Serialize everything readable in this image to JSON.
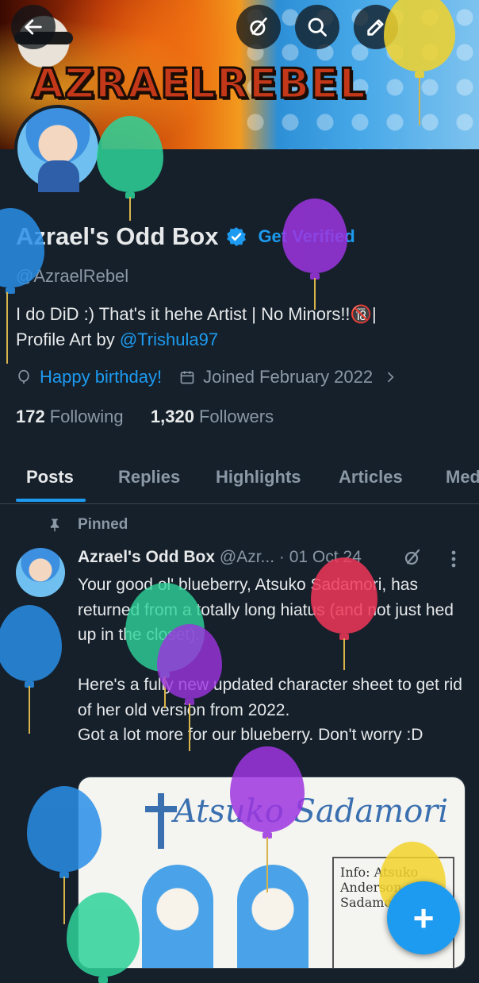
{
  "banner": {
    "title": "AZRAELREBEL"
  },
  "toolbar": {
    "back": "back",
    "grok": "grok",
    "search": "search",
    "edit": "edit"
  },
  "profile": {
    "name": "Azrael's Odd Box",
    "get_verified": "Get Verified",
    "handle": "@AzraelRebel",
    "bio_line1": "I do DiD :) That's it hehe  Artist | No Minors!!🔞|",
    "bio_line2_prefix": "Profile Art by ",
    "bio_link": "@Trishula97",
    "birthday": "Happy birthday!",
    "joined": "Joined February 2022",
    "following_count": "172",
    "following_label": "Following",
    "followers_count": "1,320",
    "followers_label": "Followers"
  },
  "tabs": [
    "Posts",
    "Replies",
    "Highlights",
    "Articles",
    "Media"
  ],
  "post": {
    "pinned_label": "Pinned",
    "author": "Azrael's Odd Box",
    "handle_short": "@Azr...",
    "date": "· 01 Oct 24",
    "text": "Your good ol' blueberry, Atsuko Sadamori, has returned from a totally long hiatus (and not just hed up in the closet).\n\nHere's a fully new updated character sheet to get rid of her old version from 2022.\nGot a lot more for our blueberry. Don't worry :D",
    "image_title": "Atsuko Sadamori",
    "image_info": "Info: Atsuko Anderson Sadamori"
  },
  "fab": "+",
  "colors": {
    "accent": "#1d9bf0",
    "background": "#15202b",
    "muted": "#8b98a5",
    "text": "#e7e9ea"
  },
  "icons": [
    "back-arrow-icon",
    "grok-icon",
    "search-icon",
    "edit-icon",
    "verified-badge-icon",
    "balloon-icon",
    "calendar-icon",
    "chevron-right-icon",
    "pin-icon",
    "more-icon",
    "compose-plus-icon"
  ]
}
